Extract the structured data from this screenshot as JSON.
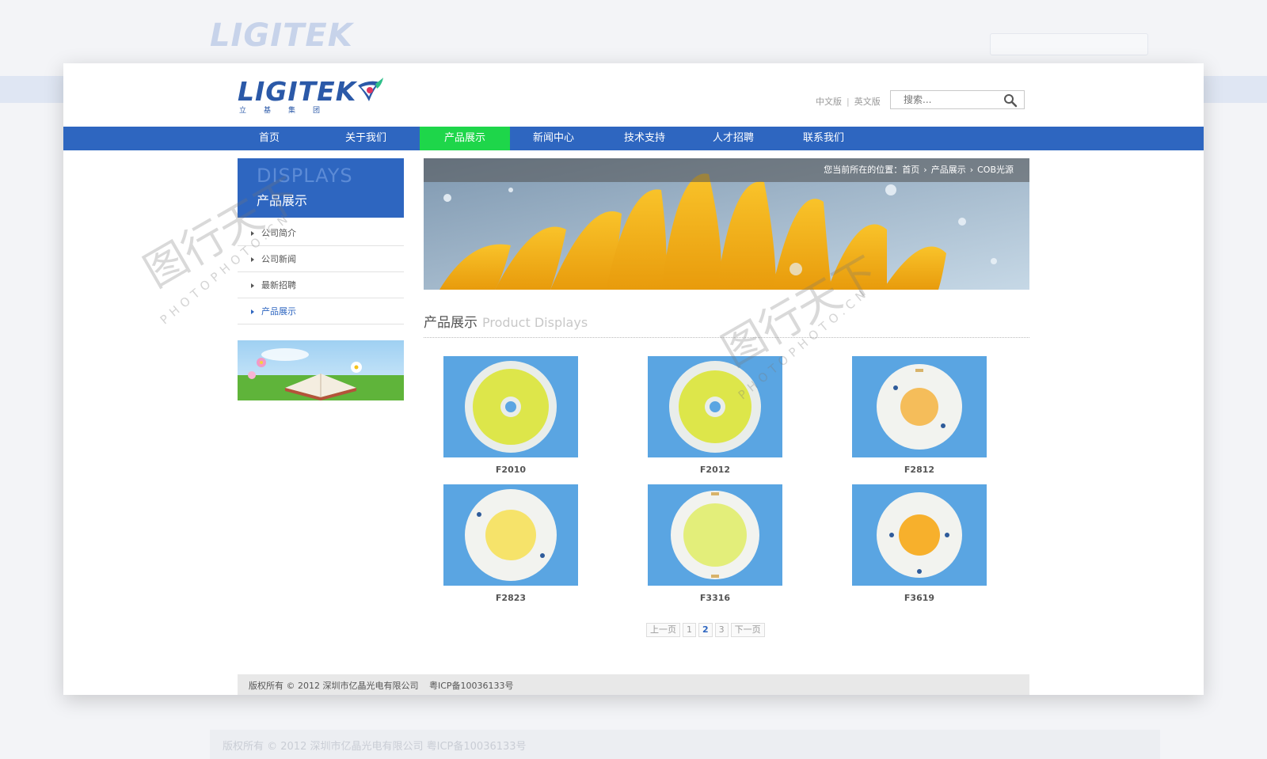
{
  "brand": {
    "logo_text": "LIGITEK",
    "logo_sub": "立基集团"
  },
  "header": {
    "lang_cn": "中文版",
    "lang_sep": "|",
    "lang_en": "英文版",
    "search_placeholder": "搜索..."
  },
  "nav": {
    "items": [
      {
        "label": "首页"
      },
      {
        "label": "关于我们"
      },
      {
        "label": "产品展示"
      },
      {
        "label": "新闻中心"
      },
      {
        "label": "技术支持"
      },
      {
        "label": "人才招聘"
      },
      {
        "label": "联系我们"
      }
    ],
    "active_index": 2
  },
  "sidebar": {
    "title_en": "DISPLAYS",
    "title_cn": "产品展示",
    "items": [
      {
        "label": "公司简介"
      },
      {
        "label": "公司新闻"
      },
      {
        "label": "最新招聘"
      },
      {
        "label": "产品展示"
      }
    ]
  },
  "breadcrumb": {
    "prefix": "您当前所在的位置：",
    "items": [
      "首页",
      "产品展示",
      "COB光源"
    ]
  },
  "section": {
    "title_cn": "产品展示",
    "title_en": "Product Displays"
  },
  "products": [
    {
      "name": "F2010"
    },
    {
      "name": "F2012"
    },
    {
      "name": "F2812"
    },
    {
      "name": "F2823"
    },
    {
      "name": "F3316"
    },
    {
      "name": "F3619"
    }
  ],
  "pagination": {
    "prev": "上一页",
    "pages": [
      "1",
      "2",
      "3"
    ],
    "current": "2",
    "next": "下一页"
  },
  "footer": {
    "copyright": "版权所有 © 2012 深圳市亿晶光电有限公司",
    "icp": "粤ICP备10036133号"
  },
  "watermark": {
    "text_en": "PHOTOPHOTO.CN",
    "text_cn": "图行天下"
  },
  "colors": {
    "nav_blue": "#2e66c0",
    "nav_active": "#1ed64a",
    "product_bg": "#5aa5e2"
  }
}
